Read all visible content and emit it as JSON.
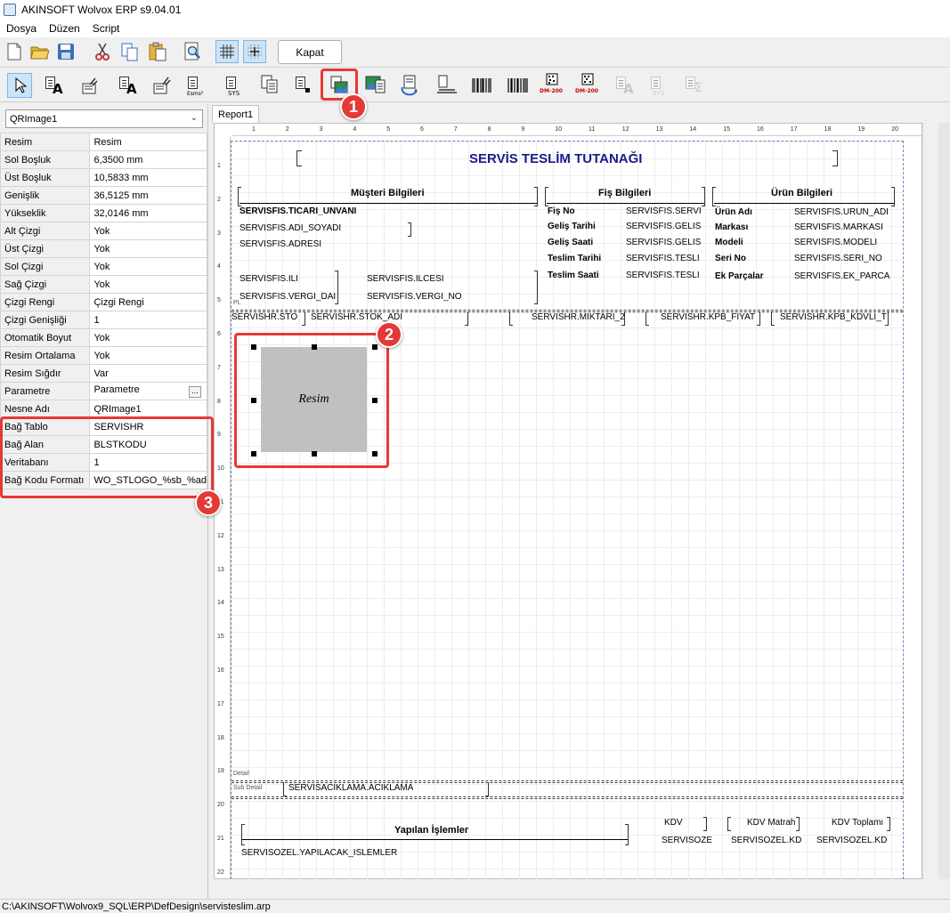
{
  "window": {
    "title": "AKINSOFT Wolvox ERP s9.04.01"
  },
  "menu": [
    "Dosya",
    "Düzen",
    "Script"
  ],
  "toolbar": {
    "close_label": "Kapat"
  },
  "toolbar2": {
    "dm_label_1": "DM-200",
    "dm_label_2": "DM-200",
    "sys_label": "SYS",
    "esms_label": "Esms²",
    "sys_label_2": "SYS"
  },
  "inspector": {
    "selected_object": "QRImage1",
    "properties": [
      {
        "key": "Resim",
        "value": "Resim"
      },
      {
        "key": "Sol Boşluk",
        "value": "6,3500 mm"
      },
      {
        "key": "Üst Boşluk",
        "value": "10,5833 mm"
      },
      {
        "key": "Genişlik",
        "value": "36,5125 mm"
      },
      {
        "key": "Yükseklik",
        "value": "32,0146 mm"
      },
      {
        "key": "Alt Çizgi",
        "value": "Yok"
      },
      {
        "key": "Üst Çizgi",
        "value": "Yok"
      },
      {
        "key": "Sol Çizgi",
        "value": "Yok"
      },
      {
        "key": "Sağ Çizgi",
        "value": "Yok"
      },
      {
        "key": "Çizgi Rengi",
        "value": "Çizgi Rengi"
      },
      {
        "key": "Çizgi Genişliği",
        "value": "1"
      },
      {
        "key": "Otomatik Boyut",
        "value": "Yok"
      },
      {
        "key": "Resim Ortalama",
        "value": "Yok"
      },
      {
        "key": "Resim Sığdır",
        "value": "Var"
      },
      {
        "key": "Parametre",
        "value": "Parametre"
      },
      {
        "key": "Nesne Adı",
        "value": "QRImage1"
      },
      {
        "key": "Bağ Tablo",
        "value": "SERVISHR"
      },
      {
        "key": "Bağ Alan",
        "value": "BLSTKODU"
      },
      {
        "key": "Veritabanı",
        "value": "1"
      },
      {
        "key": "Bağ Kodu Formatı",
        "value": "WO_STLOGO_%sb_%ad"
      }
    ],
    "dots_label": "..."
  },
  "report": {
    "tab": "Report1",
    "ruler_top": [
      "1",
      "2",
      "3",
      "4",
      "5",
      "6",
      "7",
      "8",
      "9",
      "10",
      "11",
      "12",
      "13",
      "14",
      "15",
      "16",
      "17",
      "18",
      "19",
      "20"
    ],
    "ruler_left": [
      "1",
      "2",
      "3",
      "4",
      "5",
      "6",
      "7",
      "8",
      "9",
      "10",
      "11",
      "12",
      "13",
      "14",
      "15",
      "16",
      "17",
      "18",
      "19",
      "20",
      "21",
      "22"
    ],
    "title": "SERVİS TESLİM TUTANAĞI",
    "section_customer": "Müşteri Bilgileri",
    "section_slip": "Fiş Bilgileri",
    "section_product": "Ürün Bilgileri",
    "customer_fields": [
      "SERVISFIS.TICARI_UNVANI",
      "SERVISFIS.ADI_SOYADI",
      "SERVISFIS.ADRESI",
      "SERVISFIS.ILI",
      "SERVISFIS.ILCESI",
      "SERVISFIS.VERGI_DAI",
      "SERVISFIS.VERGI_NO"
    ],
    "slip_labels": [
      "Fiş No",
      "Geliş Tarihi",
      "Geliş Saati",
      "Teslim Tarihi",
      "Teslim Saati"
    ],
    "slip_fields": [
      "SERVISFIS.SERVI",
      "SERVISFIS.GELIS",
      "SERVISFIS.GELIS",
      "SERVISFIS.TESLI",
      "SERVISFIS.TESLI"
    ],
    "product_labels": [
      "Ürün Adı",
      "Markası",
      "Modeli",
      "Seri No",
      "Ek Parçalar"
    ],
    "product_fields": [
      "SERVISFIS.URUN_ADI",
      "SERVISFIS.MARKASI",
      "SERVISFIS.MODELI",
      "SERVISFIS.SERI_NO",
      "SERVISFIS.EK_PARCA"
    ],
    "page_header_band": "PL",
    "detail_fields": [
      "SERVISHR.STO",
      "SERVISHR.STOK_ADI",
      "SERVISHR.MIKTARI_2",
      "SERVISHR.KPB_FIYAT",
      "SERVISHR.KPB_KDVLI_T"
    ],
    "image_label": "Resim",
    "band_detail": "Detail",
    "band_subdetail": "Sub Detail",
    "subdetail_field": "SERVISACIKLAMA.ACIKLAMA",
    "footer_section": "Yapılan İşlemler",
    "footer_field": "SERVISOZEL.YAPILACAK_ISLEMLER",
    "footer_kdv_label": "KDV",
    "footer_kdv_matrah_label": "KDV Matrah",
    "footer_kdv_total_label": "KDV Toplamı",
    "footer_kdv_field": "SERVISOZE",
    "footer_kdv_matrah_field": "SERVISOZEL.KD",
    "footer_kdv_total_field": "SERVISOZEL.KD"
  },
  "annotations": [
    "1",
    "2",
    "3"
  ],
  "status": {
    "path": "C:\\AKINSOFT\\Wolvox9_SQL\\ERP\\DefDesign\\servisteslim.arp"
  },
  "colors": {
    "accent_red": "#e53935",
    "title_blue": "#1a1a8c"
  }
}
